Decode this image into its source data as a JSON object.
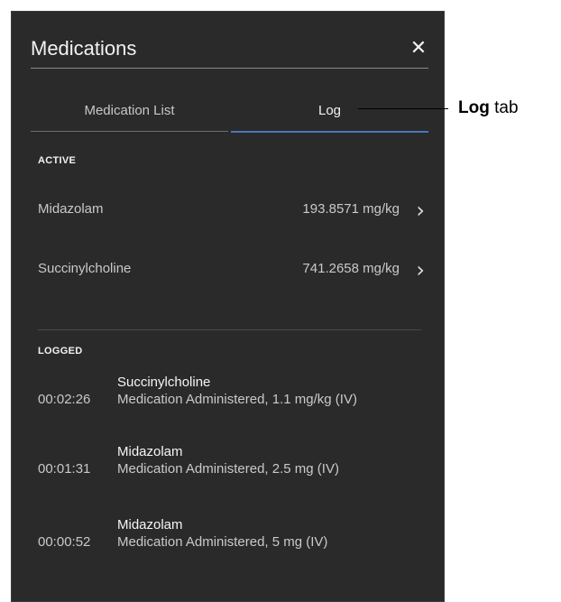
{
  "panel": {
    "title": "Medications",
    "close_icon": "close-icon"
  },
  "tabs": [
    {
      "label": "Medication List"
    },
    {
      "label": "Log"
    }
  ],
  "active": {
    "section_label": "ACTIVE",
    "items": [
      {
        "name": "Midazolam",
        "dose": "193.8571 mg/kg"
      },
      {
        "name": "Succinylcholine",
        "dose": "741.2658 mg/kg"
      }
    ]
  },
  "logged": {
    "section_label": "LOGGED",
    "entries": [
      {
        "time": "00:02:26",
        "name": "Succinylcholine",
        "detail": "Medication Administered, 1.1 mg/kg (IV)"
      },
      {
        "time": "00:01:31",
        "name": "Midazolam",
        "detail": "Medication Administered, 2.5 mg (IV)"
      },
      {
        "time": "00:00:52",
        "name": "Midazolam",
        "detail": "Medication Administered, 5 mg (IV)"
      }
    ]
  },
  "callout": {
    "bold": "Log",
    "rest": " tab"
  },
  "colors": {
    "panel_bg": "#2a2a2a",
    "tab_active_underline": "#4a78b8"
  }
}
